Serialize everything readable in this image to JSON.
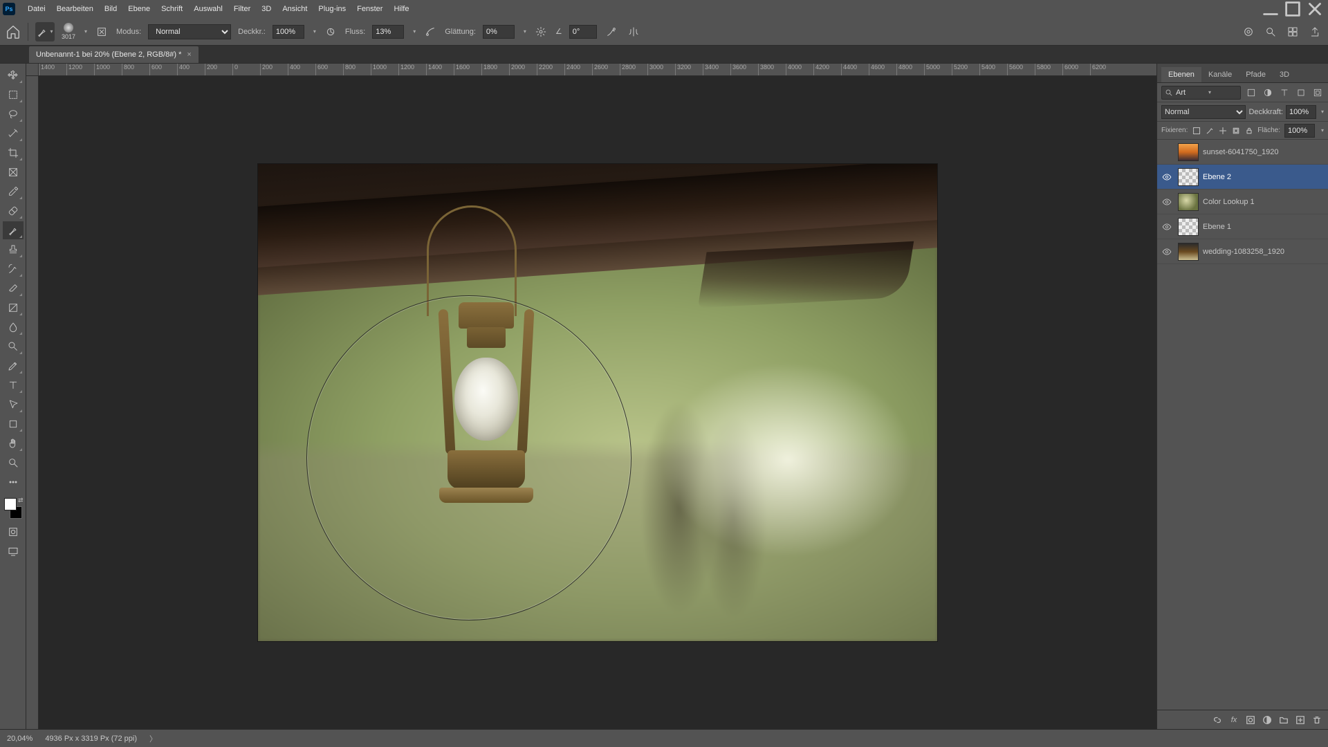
{
  "menu": [
    "Datei",
    "Bearbeiten",
    "Bild",
    "Ebene",
    "Schrift",
    "Auswahl",
    "Filter",
    "3D",
    "Ansicht",
    "Plug-ins",
    "Fenster",
    "Hilfe"
  ],
  "options": {
    "brush_size": "3017",
    "mode_label": "Modus:",
    "mode_value": "Normal",
    "opacity_label": "Deckkr.:",
    "opacity_value": "100%",
    "flow_label": "Fluss:",
    "flow_value": "13%",
    "smoothing_label": "Glättung:",
    "smoothing_value": "0%",
    "angle_icon_label": "∠",
    "angle_value": "0°"
  },
  "document": {
    "tab_title": "Unbenannt-1 bei 20% (Ebene 2, RGB/8#) *",
    "zoom": "20,04%",
    "info": "4936 Px x 3319 Px (72 ppi)"
  },
  "ruler_ticks": [
    "1400",
    "1200",
    "1000",
    "800",
    "600",
    "400",
    "200",
    "0",
    "200",
    "400",
    "600",
    "800",
    "1000",
    "1200",
    "1400",
    "1600",
    "1800",
    "2000",
    "2200",
    "2400",
    "2600",
    "2800",
    "3000",
    "3200",
    "3400",
    "3600",
    "3800",
    "4000",
    "4200",
    "4400",
    "4600",
    "4800",
    "5000",
    "5200",
    "5400",
    "5600",
    "5800",
    "6000",
    "6200"
  ],
  "panel": {
    "tabs": [
      "Ebenen",
      "Kanäle",
      "Pfade",
      "3D"
    ],
    "search_mode": "Art",
    "blend_mode": "Normal",
    "opacity_label": "Deckkraft:",
    "opacity_value": "100%",
    "lock_label": "Fixieren:",
    "fill_label": "Fläche:",
    "fill_value": "100%"
  },
  "layers": [
    {
      "name": "sunset-6041750_1920",
      "visible": false,
      "thumb": "img1",
      "selected": false
    },
    {
      "name": "Ebene 2",
      "visible": true,
      "thumb": "checker",
      "selected": true
    },
    {
      "name": "Color Lookup 1",
      "visible": true,
      "thumb": "img2",
      "selected": false
    },
    {
      "name": "Ebene 1",
      "visible": true,
      "thumb": "checker",
      "selected": false
    },
    {
      "name": "wedding-1083258_1920",
      "visible": true,
      "thumb": "img3",
      "selected": false
    }
  ],
  "colors": {
    "fg": "#ffffff",
    "bg": "#000000"
  }
}
